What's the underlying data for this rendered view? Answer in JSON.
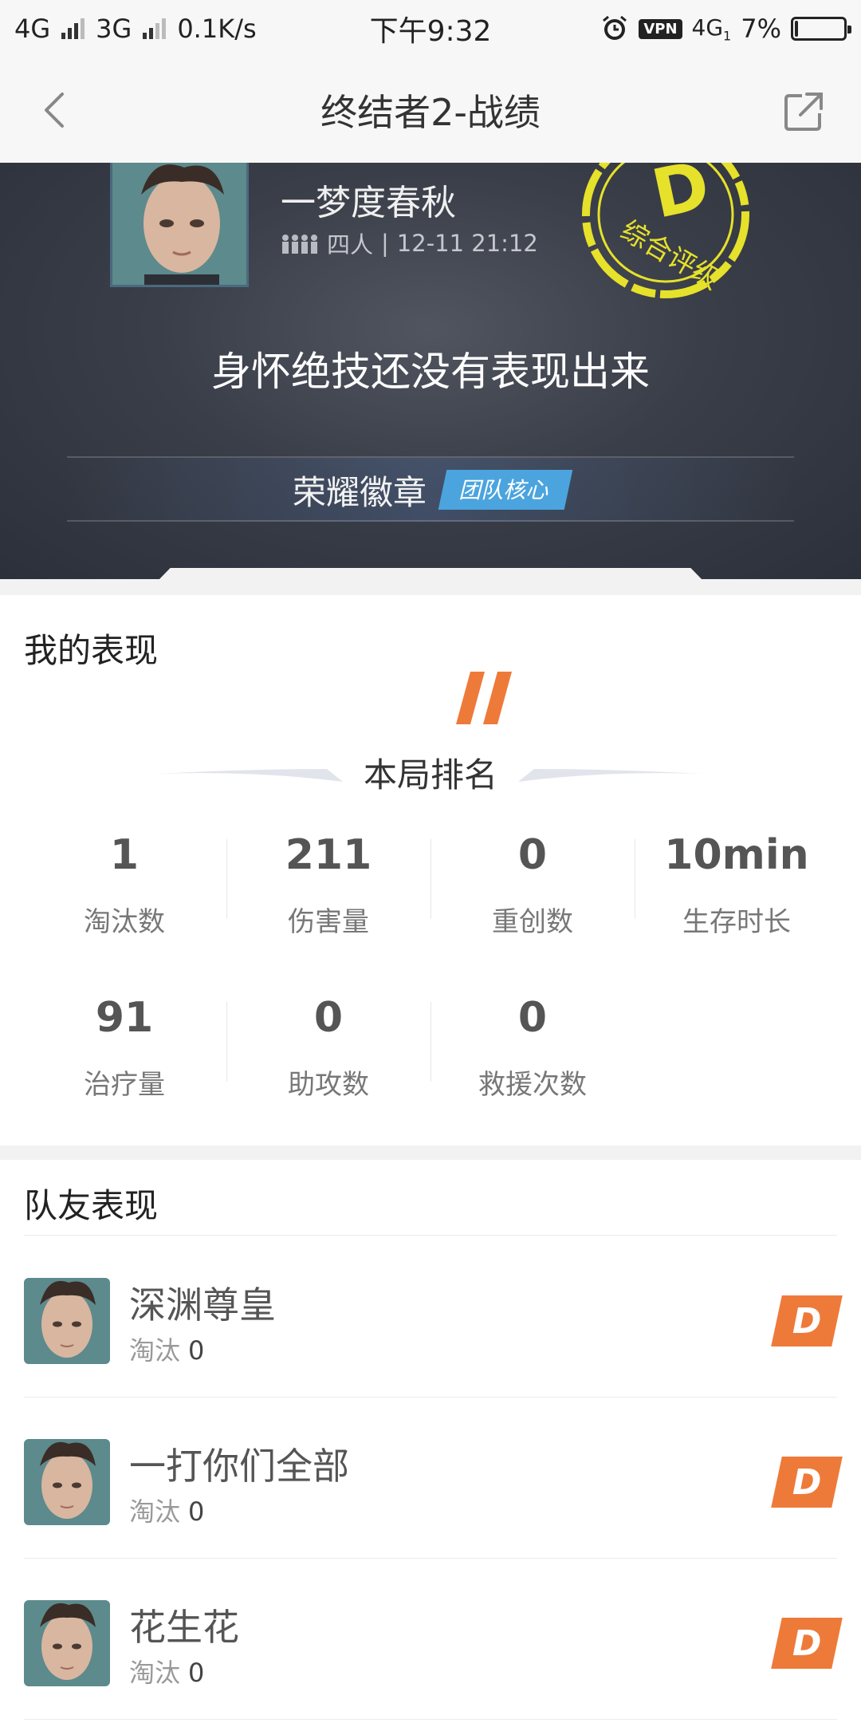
{
  "status_bar": {
    "net1": "4G",
    "net2": "3G",
    "speed": "0.1K/s",
    "time": "下午9:32",
    "vpn": "VPN",
    "net3": "4G",
    "net3_sub": "1",
    "battery": "7%",
    "battery_level": 0.07
  },
  "nav": {
    "title": "终结者2-战绩"
  },
  "hero": {
    "player_name": "一梦度春秋",
    "mode": "四人",
    "separator": "|",
    "datetime": "12-11 21:12",
    "grade": "D",
    "grade_label": "综合评级",
    "slogan": "身怀绝技还没有表现出来",
    "badge_label": "荣耀徽章",
    "badge_tag": "团队核心"
  },
  "performance": {
    "title": "我的表现",
    "rank_label": "本局排名",
    "row1": [
      {
        "value": "1",
        "label": "淘汰数"
      },
      {
        "value": "211",
        "label": "伤害量"
      },
      {
        "value": "0",
        "label": "重创数"
      },
      {
        "value": "10min",
        "label": "生存时长"
      }
    ],
    "row2": [
      {
        "value": "91",
        "label": "治疗量"
      },
      {
        "value": "0",
        "label": "助攻数"
      },
      {
        "value": "0",
        "label": "救援次数"
      }
    ]
  },
  "teammates": {
    "title": "队友表现",
    "elim_label": "淘汰",
    "items": [
      {
        "name": "深渊尊皇",
        "elims": "0",
        "grade": "D"
      },
      {
        "name": "一打你们全部",
        "elims": "0",
        "grade": "D"
      },
      {
        "name": "花生花",
        "elims": "0",
        "grade": "D"
      }
    ]
  },
  "colors": {
    "accent_orange": "#ee7a3a",
    "badge_blue": "#4ba4de",
    "stamp_yellow": "#e6e12a",
    "hero_bg": "#363a44"
  }
}
